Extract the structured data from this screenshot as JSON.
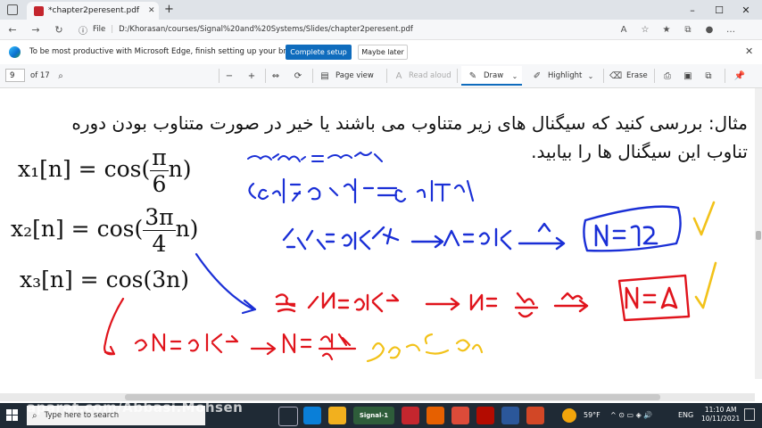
{
  "browser": {
    "tab_title": "*chapter2peresent.pdf",
    "tab_close": "✕",
    "new_tab": "+",
    "window_controls": {
      "minimize": "–",
      "maximize": "☐",
      "close": "✕"
    },
    "address": {
      "label": "File",
      "url": "D:/Khorasan/courses/Signal%20and%20Systems/Slides/chapter2peresent.pdf"
    }
  },
  "notification": {
    "text": "To be most productive with Microsoft Edge, finish setting up your browser.",
    "primary_button": "Complete setup",
    "secondary_button": "Maybe later"
  },
  "pdf_toolbar": {
    "page_input": "9",
    "page_total": "of 17",
    "page_view": "Page view",
    "read_aloud": "Read aloud",
    "draw": "Draw",
    "highlight": "Highlight",
    "erase": "Erase"
  },
  "slide": {
    "line1": "مثال: بررسی کنید که سیگنال های زیر متناوب می باشند یا خیر در صورت متناوب بودن دوره",
    "line2": "تناوب این سیگنال ها را بیابید.",
    "eq1": {
      "lhs": "x₁[n] = cos(",
      "num": "π",
      "den": "6",
      "rhs": "n)"
    },
    "eq2": {
      "lhs": "x₂[n] = cos(",
      "num": "3π",
      "den": "4",
      "rhs": "n)"
    },
    "eq3": {
      "text": "x₃[n] = cos(3n)"
    },
    "page_number": "9"
  },
  "taskbar": {
    "search_placeholder": "Type here to search",
    "weather": "59°F",
    "language": "ENG",
    "time": "11:10 AM",
    "date": "10/11/2021",
    "app_label": "Signal-1"
  },
  "watermark": "aparat.com/Abbasi.Mohsen",
  "colors": {
    "accent": "#0f6cbd",
    "ink_blue": "#1a2fd6",
    "ink_red": "#e0141c",
    "ink_yellow": "#f2c21a",
    "taskbar": "#1f2a35"
  }
}
